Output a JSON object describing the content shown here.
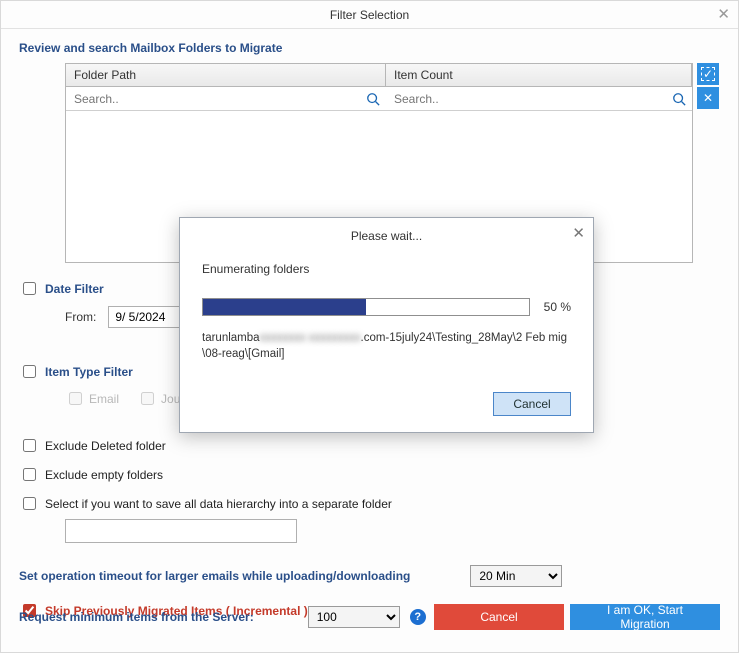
{
  "window": {
    "title": "Filter Selection"
  },
  "section": {
    "review_label": "Review and search Mailbox Folders to Migrate"
  },
  "grid": {
    "columns": {
      "path": "Folder Path",
      "count": "Item Count"
    },
    "search_placeholder": "Search.."
  },
  "filters": {
    "date_filter_label": "Date Filter",
    "from_label": "From:",
    "from_value": "9/ 5/2024",
    "item_type_label": "Item Type Filter",
    "types": {
      "email": "Email",
      "journal": "Journal"
    },
    "exclude_deleted": "Exclude Deleted folder",
    "exclude_empty": "Exclude empty folders",
    "save_hierarchy": "Select if you want to save all data hierarchy into a separate folder"
  },
  "timeout": {
    "label": "Set operation timeout for larger emails while uploading/downloading",
    "value": "20 Min"
  },
  "skip": {
    "label": "Skip Previously Migrated Items ( Incremental )"
  },
  "request": {
    "label": "Request minimum items from the Server:",
    "value": "100"
  },
  "buttons": {
    "cancel": "Cancel",
    "ok": "I am OK, Start Migration"
  },
  "modal": {
    "title": "Please wait...",
    "enumerating": "Enumerating folders",
    "progress_pct": 50,
    "pct_text": "50 %",
    "path_prefix": "tarunlamba",
    "path_blur": "xxxxxxxx xxxxxxxxx",
    "path_suffix": ".com-15july24\\Testing_28May\\2 Feb mig\\08-reag\\[Gmail]",
    "cancel": "Cancel"
  }
}
